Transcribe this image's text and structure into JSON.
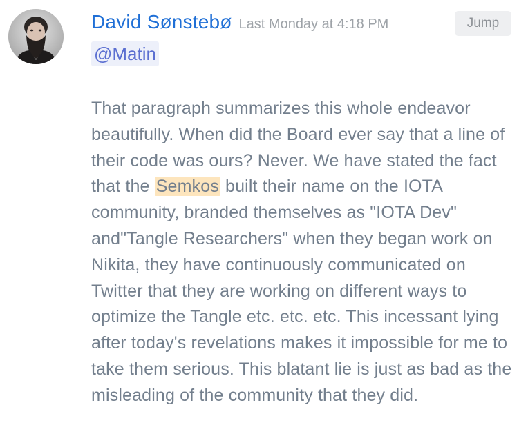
{
  "message": {
    "author": "David Sønstebø",
    "timestamp": "Last Monday at 4:18 PM",
    "jump_label": "Jump",
    "mention": "@Matin",
    "avatar_icon": "user-avatar-bearded-man",
    "body_before_highlight": "That paragraph summarizes this whole endeavor beautifully. When did the Board ever say that a line of their code was ours? Never. We have stated the fact that the ",
    "highlight": "Semkos",
    "body_after_highlight": " built their name on the IOTA community, branded themselves as \"IOTA Dev\" and\"Tangle Researchers\" when they began work on Nikita, they have continuously communicated on Twitter that they are working on different ways to optimize the Tangle etc. etc. etc. This incessant lying after today's revelations makes it impossible for me to take them serious. This blatant lie is just as bad as the misleading of the community that they did."
  },
  "colors": {
    "author": "#1f6fd6",
    "timestamp": "#9ea3a8",
    "body_text": "#737f8d",
    "mention_text": "#5b6fd1",
    "mention_bg": "#edf0fa",
    "highlight_bg": "#fde5bd",
    "jump_bg": "#eeeff1"
  }
}
